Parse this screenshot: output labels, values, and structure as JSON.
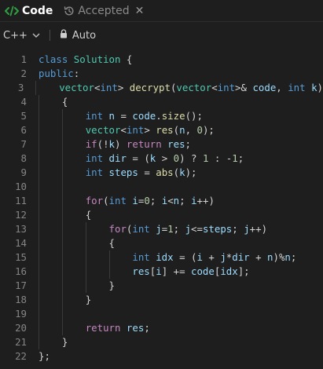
{
  "tabs": {
    "code_label": "Code",
    "accepted_label": "Accepted"
  },
  "toolbar": {
    "language": "C++",
    "mode": "Auto"
  },
  "colors": {
    "background": "#1e1e1e",
    "line_number": "#858585",
    "keyword": "#569cd6",
    "type": "#4ec9b0",
    "function": "#dcdcaa",
    "number": "#b5cea8",
    "control": "#c586c0"
  },
  "icons": [
    "code-icon",
    "history-icon",
    "close-icon",
    "chevron-down-icon",
    "lock-icon"
  ],
  "editor": {
    "lines": [
      {
        "n": "1",
        "indent": 0,
        "tokens": [
          [
            "kw",
            "class"
          ],
          [
            "op",
            " "
          ],
          [
            "ty",
            "Solution"
          ],
          [
            "op",
            " {"
          ]
        ]
      },
      {
        "n": "2",
        "indent": 0,
        "tokens": [
          [
            "kw",
            "public"
          ],
          [
            "op",
            ":"
          ]
        ]
      },
      {
        "n": "3",
        "indent": 1,
        "tokens": [
          [
            "ty",
            "vector"
          ],
          [
            "op",
            "<"
          ],
          [
            "kw",
            "int"
          ],
          [
            "op",
            "> "
          ],
          [
            "fn",
            "decrypt"
          ],
          [
            "op",
            "("
          ],
          [
            "ty",
            "vector"
          ],
          [
            "op",
            "<"
          ],
          [
            "kw",
            "int"
          ],
          [
            "op",
            ">& "
          ],
          [
            "var",
            "code"
          ],
          [
            "op",
            ", "
          ],
          [
            "kw",
            "int"
          ],
          [
            "op",
            " "
          ],
          [
            "var",
            "k"
          ],
          [
            "op",
            ")"
          ]
        ]
      },
      {
        "n": "4",
        "indent": 1,
        "tokens": [
          [
            "op",
            "{"
          ]
        ]
      },
      {
        "n": "5",
        "indent": 2,
        "tokens": [
          [
            "kw",
            "int"
          ],
          [
            "op",
            " "
          ],
          [
            "var",
            "n"
          ],
          [
            "op",
            " = "
          ],
          [
            "var",
            "code"
          ],
          [
            "op",
            "."
          ],
          [
            "fn",
            "size"
          ],
          [
            "op",
            "();"
          ]
        ]
      },
      {
        "n": "6",
        "indent": 2,
        "tokens": [
          [
            "ty",
            "vector"
          ],
          [
            "op",
            "<"
          ],
          [
            "kw",
            "int"
          ],
          [
            "op",
            "> "
          ],
          [
            "fn",
            "res"
          ],
          [
            "op",
            "("
          ],
          [
            "var",
            "n"
          ],
          [
            "op",
            ", "
          ],
          [
            "num",
            "0"
          ],
          [
            "op",
            ");"
          ]
        ]
      },
      {
        "n": "7",
        "indent": 2,
        "tokens": [
          [
            "ctl",
            "if"
          ],
          [
            "op",
            "(!"
          ],
          [
            "var",
            "k"
          ],
          [
            "op",
            ") "
          ],
          [
            "ctl",
            "return"
          ],
          [
            "op",
            " "
          ],
          [
            "var",
            "res"
          ],
          [
            "op",
            ";"
          ]
        ]
      },
      {
        "n": "8",
        "indent": 2,
        "tokens": [
          [
            "kw",
            "int"
          ],
          [
            "op",
            " "
          ],
          [
            "var",
            "dir"
          ],
          [
            "op",
            " = ("
          ],
          [
            "var",
            "k"
          ],
          [
            "op",
            " > "
          ],
          [
            "num",
            "0"
          ],
          [
            "op",
            ") ? "
          ],
          [
            "num",
            "1"
          ],
          [
            "op",
            " : -"
          ],
          [
            "num",
            "1"
          ],
          [
            "op",
            ";"
          ]
        ]
      },
      {
        "n": "9",
        "indent": 2,
        "tokens": [
          [
            "kw",
            "int"
          ],
          [
            "op",
            " "
          ],
          [
            "var",
            "steps"
          ],
          [
            "op",
            " = "
          ],
          [
            "fn",
            "abs"
          ],
          [
            "op",
            "("
          ],
          [
            "var",
            "k"
          ],
          [
            "op",
            ");"
          ]
        ]
      },
      {
        "n": "10",
        "indent": 2,
        "tokens": []
      },
      {
        "n": "11",
        "indent": 2,
        "tokens": [
          [
            "ctl",
            "for"
          ],
          [
            "op",
            "("
          ],
          [
            "kw",
            "int"
          ],
          [
            "op",
            " "
          ],
          [
            "var",
            "i"
          ],
          [
            "op",
            "="
          ],
          [
            "num",
            "0"
          ],
          [
            "op",
            "; "
          ],
          [
            "var",
            "i"
          ],
          [
            "op",
            "<"
          ],
          [
            "var",
            "n"
          ],
          [
            "op",
            "; "
          ],
          [
            "var",
            "i"
          ],
          [
            "op",
            "++)"
          ]
        ]
      },
      {
        "n": "12",
        "indent": 2,
        "tokens": [
          [
            "op",
            "{"
          ]
        ]
      },
      {
        "n": "13",
        "indent": 3,
        "tokens": [
          [
            "ctl",
            "for"
          ],
          [
            "op",
            "("
          ],
          [
            "kw",
            "int"
          ],
          [
            "op",
            " "
          ],
          [
            "var",
            "j"
          ],
          [
            "op",
            "="
          ],
          [
            "num",
            "1"
          ],
          [
            "op",
            "; "
          ],
          [
            "var",
            "j"
          ],
          [
            "op",
            "<="
          ],
          [
            "var",
            "steps"
          ],
          [
            "op",
            "; "
          ],
          [
            "var",
            "j"
          ],
          [
            "op",
            "++)"
          ]
        ]
      },
      {
        "n": "14",
        "indent": 3,
        "tokens": [
          [
            "op",
            "{"
          ]
        ]
      },
      {
        "n": "15",
        "indent": 4,
        "tokens": [
          [
            "kw",
            "int"
          ],
          [
            "op",
            " "
          ],
          [
            "var",
            "idx"
          ],
          [
            "op",
            " = ("
          ],
          [
            "var",
            "i"
          ],
          [
            "op",
            " + "
          ],
          [
            "var",
            "j"
          ],
          [
            "op",
            "*"
          ],
          [
            "var",
            "dir"
          ],
          [
            "op",
            " + "
          ],
          [
            "var",
            "n"
          ],
          [
            "op",
            ")%"
          ],
          [
            "var",
            "n"
          ],
          [
            "op",
            ";"
          ]
        ]
      },
      {
        "n": "16",
        "indent": 4,
        "tokens": [
          [
            "var",
            "res"
          ],
          [
            "op",
            "["
          ],
          [
            "var",
            "i"
          ],
          [
            "op",
            "] += "
          ],
          [
            "var",
            "code"
          ],
          [
            "op",
            "["
          ],
          [
            "var",
            "idx"
          ],
          [
            "op",
            "];"
          ]
        ]
      },
      {
        "n": "17",
        "indent": 3,
        "tokens": [
          [
            "op",
            "}"
          ]
        ]
      },
      {
        "n": "18",
        "indent": 2,
        "tokens": [
          [
            "op",
            "}"
          ]
        ]
      },
      {
        "n": "19",
        "indent": 2,
        "tokens": []
      },
      {
        "n": "20",
        "indent": 2,
        "tokens": [
          [
            "ctl",
            "return"
          ],
          [
            "op",
            " "
          ],
          [
            "var",
            "res"
          ],
          [
            "op",
            ";"
          ]
        ]
      },
      {
        "n": "21",
        "indent": 1,
        "tokens": [
          [
            "op",
            "}"
          ]
        ]
      },
      {
        "n": "22",
        "indent": 0,
        "tokens": [
          [
            "op",
            "};"
          ]
        ]
      }
    ]
  }
}
